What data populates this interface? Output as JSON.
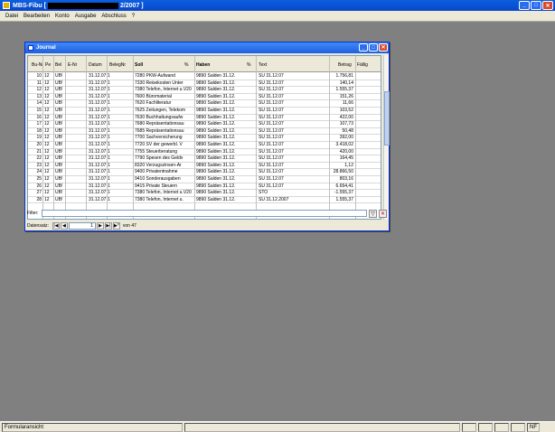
{
  "app": {
    "title_prefix": "MBS-Fibu [",
    "title_suffix": "2/2007 ]"
  },
  "menu": [
    "Datei",
    "Bearbeiten",
    "Konto",
    "Ausgabe",
    "Abschluss",
    "?"
  ],
  "journal": {
    "title": "Journal",
    "columns": [
      "Bu-Nr",
      "Pe",
      "Bel",
      "E-Nr",
      "Datum",
      "BelegNr",
      "Soll",
      "%",
      "Haben",
      "%",
      "Text",
      "Betrag",
      "Fällig"
    ],
    "rows": [
      {
        "bu": "10",
        "pe": "12",
        "bel": "UB!",
        "datum": "31.12.07",
        "belegnr": "1",
        "soll": "7280 PKW-Aufwand",
        "haben": "9890 Salden 31.12.",
        "text": "SU 31.12.07",
        "betrag": "1.756,81"
      },
      {
        "bu": "11",
        "pe": "12",
        "bel": "UB!",
        "datum": "31.12.07",
        "belegnr": "1",
        "soll": "7330 Reisekosten Unter",
        "haben": "9890 Salden 31.12.",
        "text": "SU 31.12.07",
        "betrag": "140,14"
      },
      {
        "bu": "12",
        "pe": "12",
        "bel": "UB!",
        "datum": "31.12.07",
        "belegnr": "1",
        "soll": "7380 Telefon, Internet u.V20",
        "haben": "9890 Salden 31.12.",
        "text": "SU 31.12.07",
        "betrag": "1.555,37"
      },
      {
        "bu": "13",
        "pe": "12",
        "bel": "UB!",
        "datum": "31.12.07",
        "belegnr": "1",
        "soll": "7600 Büromaterial",
        "haben": "9890 Salden 31.12.",
        "text": "SU 31.12.07",
        "betrag": "151,26"
      },
      {
        "bu": "14",
        "pe": "12",
        "bel": "UB!",
        "datum": "31.12.07",
        "belegnr": "1",
        "soll": "7620 Fachliteratur",
        "haben": "9890 Salden 31.12.",
        "text": "SU 31.12.07",
        "betrag": "11,66"
      },
      {
        "bu": "15",
        "pe": "12",
        "bel": "UB!",
        "datum": "31.12.07",
        "belegnr": "1",
        "soll": "7625 Zeitungen, Telekom",
        "haben": "9890 Salden 31.12.",
        "text": "SU 31.12.07",
        "betrag": "103,52"
      },
      {
        "bu": "16",
        "pe": "12",
        "bel": "UB!",
        "datum": "31.12.07",
        "belegnr": "1",
        "soll": "7630 Buchhaltungsaufw",
        "haben": "9890 Salden 31.12.",
        "text": "SU 31.12.07",
        "betrag": "422,00"
      },
      {
        "bu": "17",
        "pe": "12",
        "bel": "UB!",
        "datum": "31.12.07",
        "belegnr": "1",
        "soll": "7680 Repräsentationsau",
        "haben": "9890 Salden 31.12.",
        "text": "SU 31.12.07",
        "betrag": "107,73"
      },
      {
        "bu": "18",
        "pe": "12",
        "bel": "UB!",
        "datum": "31.12.07",
        "belegnr": "1",
        "soll": "7685 Repräsentationsau",
        "haben": "9890 Salden 31.12.",
        "text": "SU 31.12.07",
        "betrag": "50,48"
      },
      {
        "bu": "19",
        "pe": "12",
        "bel": "UB!",
        "datum": "31.12.07",
        "belegnr": "1",
        "soll": "7700 Sachversicherung",
        "haben": "9890 Salden 31.12.",
        "text": "SU 31.12.07",
        "betrag": "392,00"
      },
      {
        "bu": "20",
        "pe": "12",
        "bel": "UB!",
        "datum": "31.12.07",
        "belegnr": "1",
        "soll": "7720 SV der gewerbl. V",
        "haben": "9890 Salden 31.12.",
        "text": "SU 31.12.07",
        "betrag": "3.418,02"
      },
      {
        "bu": "21",
        "pe": "12",
        "bel": "UB!",
        "datum": "31.12.07",
        "belegnr": "1",
        "soll": "7755 Steuerberatung",
        "haben": "9890 Salden 31.12.",
        "text": "SU 31.12.07",
        "betrag": "420,00"
      },
      {
        "bu": "22",
        "pe": "12",
        "bel": "UB!",
        "datum": "31.12.07",
        "belegnr": "1",
        "soll": "7790 Spesen des Geldv",
        "haben": "9890 Salden 31.12.",
        "text": "SU 31.12.07",
        "betrag": "164,45"
      },
      {
        "bu": "23",
        "pe": "12",
        "bel": "UB!",
        "datum": "31.12.07",
        "belegnr": "1",
        "soll": "8320 Verzugszinsen-Ar",
        "haben": "9890 Salden 31.12.",
        "text": "SU 31.12.07",
        "betrag": "1,12"
      },
      {
        "bu": "24",
        "pe": "12",
        "bel": "UB!",
        "datum": "31.12.07",
        "belegnr": "1",
        "soll": "9400 Privatentnahme",
        "haben": "9890 Salden 31.12.",
        "text": "SU 31.12.07",
        "betrag": "28.866,50"
      },
      {
        "bu": "25",
        "pe": "12",
        "bel": "UB!",
        "datum": "31.12.07",
        "belegnr": "1",
        "soll": "9410 Sonderausgaben",
        "haben": "9890 Salden 31.12.",
        "text": "SU 31.12.07",
        "betrag": "803,16"
      },
      {
        "bu": "26",
        "pe": "12",
        "bel": "UB!",
        "datum": "31.12.07",
        "belegnr": "1",
        "soll": "9415 Private Steuern",
        "haben": "9890 Salden 31.12.",
        "text": "SU 31.12.07",
        "betrag": "6.654,41"
      },
      {
        "bu": "27",
        "pe": "12",
        "bel": "UB!",
        "datum": "31.12.07",
        "belegnr": "1",
        "soll": "7380 Telefon, Internet u.V20",
        "haben": "9890 Salden 31.12.",
        "text": "STO",
        "betrag": "-1.555,37"
      },
      {
        "bu": "28",
        "pe": "12",
        "bel": "UB!",
        "datum": "31.12.07",
        "belegnr": "1",
        "soll": "7380 Telefon, Internet u.",
        "haben": "9890 Salden 31.12.",
        "text": "SU 31.12.2007",
        "betrag": "1.555,37"
      }
    ],
    "filter_label": "Filter:",
    "nav_label": "Datensatz:",
    "current_record": "1",
    "record_total": "von 47"
  },
  "status": {
    "left": "Formularansicht",
    "right": "NF"
  }
}
